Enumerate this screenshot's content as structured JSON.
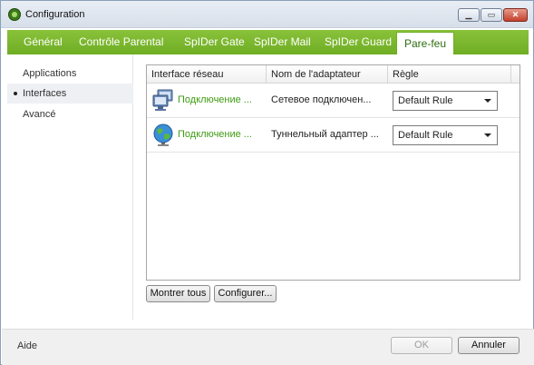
{
  "window": {
    "title": "Configuration",
    "controls": {
      "minimize": "▁",
      "maximize": "▭",
      "close": "✕"
    }
  },
  "tabs": [
    {
      "label": "Général"
    },
    {
      "label": "Contrôle Parental"
    },
    {
      "label": "SpIDer Gate"
    },
    {
      "label": "SpIDer Mail"
    },
    {
      "label": "SpIDer Guard"
    },
    {
      "label": "Pare-feu",
      "active": true
    }
  ],
  "sidebar": {
    "items": [
      {
        "label": "Applications"
      },
      {
        "label": "Interfaces",
        "selected": true
      },
      {
        "label": "Avancé"
      }
    ]
  },
  "table": {
    "columns": [
      "Interface réseau",
      "Nom de l'adaptateur",
      "Règle"
    ],
    "rows": [
      {
        "icon": "monitor-network-icon",
        "interface": "Подключение ...",
        "adapter": "Сетевое подключен...",
        "rule": "Default Rule"
      },
      {
        "icon": "globe-network-icon",
        "interface": "Подключение ...",
        "adapter": "Туннельный адаптер ...",
        "rule": "Default Rule"
      }
    ]
  },
  "actions": {
    "show_all": "Montrer tous",
    "configure": "Configurer..."
  },
  "footer": {
    "help": "Aide",
    "ok": "OK",
    "cancel": "Annuler"
  },
  "colors": {
    "tab_bar": "#7cb82f",
    "interface_text": "#3e9a12"
  }
}
